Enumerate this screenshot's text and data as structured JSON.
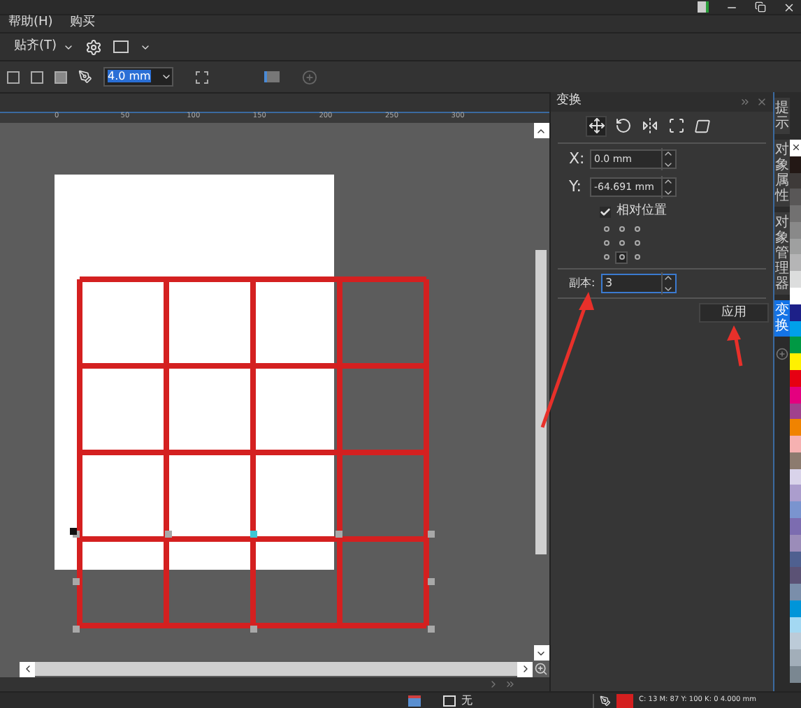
{
  "menu": [
    {
      "label": "帮助(H)"
    },
    {
      "label": "购买"
    }
  ],
  "toolbar": {
    "snap": "贴齐(T)"
  },
  "property_bar": {
    "outline_width": "4.0 mm"
  },
  "ruler": {
    "labels": [
      "0",
      "50",
      "100",
      "150",
      "200",
      "250",
      "300"
    ]
  },
  "docker": {
    "title": "变换",
    "modes": [
      {
        "kind": "position",
        "selected": true
      },
      {
        "kind": "rotate",
        "selected": false
      },
      {
        "kind": "mirror",
        "selected": false
      },
      {
        "kind": "size",
        "selected": false
      },
      {
        "kind": "skew",
        "selected": false
      }
    ],
    "x": {
      "label": "X:",
      "value": "0.0 mm"
    },
    "y": {
      "label": "Y:",
      "value": "-64.691 mm"
    },
    "relative_position": {
      "label": "相对位置",
      "checked": true
    },
    "anchors": [
      {
        "selected": false
      },
      {
        "selected": false
      },
      {
        "selected": false
      },
      {
        "selected": false
      },
      {
        "selected": false
      },
      {
        "selected": false
      },
      {
        "selected": false
      },
      {
        "selected": true
      },
      {
        "selected": false
      }
    ],
    "copies": {
      "label": "副本:",
      "value": "3"
    },
    "apply": "应用"
  },
  "side_tabs": [
    {
      "label": "提示",
      "selected": false
    },
    {
      "label": "对象属性",
      "selected": false
    },
    {
      "label": "对象管理器",
      "selected": false
    },
    {
      "label": "变换",
      "selected": true
    }
  ],
  "palette": [
    {
      "color": "#ffffff",
      "kind": "none"
    },
    {
      "color": "#231815",
      "kind": "swatch"
    },
    {
      "color": "#3e3a39",
      "kind": "swatch"
    },
    {
      "color": "#595757",
      "kind": "swatch"
    },
    {
      "color": "#727171",
      "kind": "swatch"
    },
    {
      "color": "#898989",
      "kind": "swatch"
    },
    {
      "color": "#9fa0a0",
      "kind": "swatch"
    },
    {
      "color": "#b5b5b6",
      "kind": "swatch"
    },
    {
      "color": "#dcdddd",
      "kind": "swatch"
    },
    {
      "color": "#ffffff",
      "kind": "swatch"
    },
    {
      "color": "#1d2088",
      "kind": "swatch"
    },
    {
      "color": "#00a0e9",
      "kind": "swatch"
    },
    {
      "color": "#009944",
      "kind": "swatch"
    },
    {
      "color": "#fff100",
      "kind": "swatch"
    },
    {
      "color": "#e60012",
      "kind": "swatch"
    },
    {
      "color": "#e4007f",
      "kind": "swatch"
    },
    {
      "color": "#a0418d",
      "kind": "swatch"
    },
    {
      "color": "#f08300",
      "kind": "swatch"
    },
    {
      "color": "#f6b1b1",
      "kind": "swatch"
    },
    {
      "color": "#8c7b6f",
      "kind": "swatch"
    },
    {
      "color": "#d9d3ea",
      "kind": "swatch"
    },
    {
      "color": "#ab9dcd",
      "kind": "swatch"
    },
    {
      "color": "#7a94cf",
      "kind": "swatch"
    },
    {
      "color": "#7c6cb0",
      "kind": "swatch"
    },
    {
      "color": "#9b8cb9",
      "kind": "swatch"
    },
    {
      "color": "#4f6090",
      "kind": "swatch"
    },
    {
      "color": "#5b5275",
      "kind": "swatch"
    },
    {
      "color": "#7a8eaa",
      "kind": "swatch"
    },
    {
      "color": "#0095d9",
      "kind": "swatch"
    },
    {
      "color": "#a3d8f2",
      "kind": "swatch"
    },
    {
      "color": "#bccbd8",
      "kind": "swatch"
    },
    {
      "color": "#a2aeb9",
      "kind": "swatch"
    },
    {
      "color": "#7a8791",
      "kind": "swatch"
    }
  ],
  "status_bar": {
    "fill": "无",
    "color_swatch": {
      "color": "#d41f1f"
    },
    "color_info": "C: 13 M: 87 Y: 100 K: 0  4.000 mm"
  }
}
